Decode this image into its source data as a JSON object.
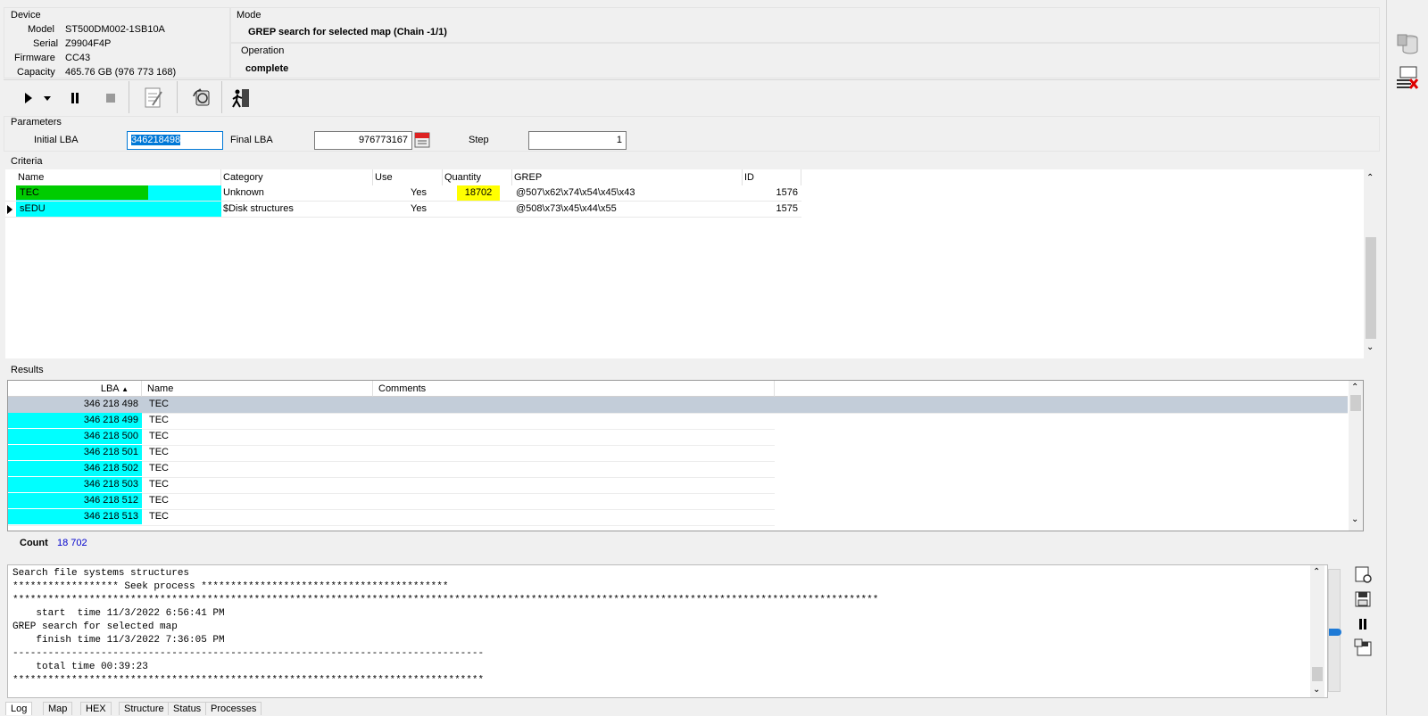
{
  "device": {
    "title": "Device",
    "model_label": "Model",
    "model": "ST500DM002-1SB10A",
    "serial_label": "Serial",
    "serial": "Z9904F4P",
    "firmware_label": "Firmware",
    "firmware": "CC43",
    "capacity_label": "Capacity",
    "capacity": "465.76 GB (976 773 168)"
  },
  "mode": {
    "title": "Mode",
    "value": "GREP search for selected map (Chain -1/1)"
  },
  "operation": {
    "title": "Operation",
    "value": "complete"
  },
  "parameters": {
    "title": "Parameters",
    "initial_lba_label": "Initial LBA",
    "initial_lba": "346218498",
    "final_lba_label": "Final  LBA",
    "final_lba": "976773167",
    "step_label": "Step",
    "step": "1"
  },
  "criteria": {
    "title": "Criteria",
    "columns": [
      "Name",
      "Category",
      "Use",
      "Quantity",
      "GREP",
      "ID"
    ],
    "rows": [
      {
        "name": "TEC",
        "category": "Unknown",
        "use": "Yes",
        "quantity": "18702",
        "grep": "@507\\x62\\x74\\x54\\x45\\x43",
        "id": "1576"
      },
      {
        "name": "sEDU",
        "category": "$Disk structures",
        "use": "Yes",
        "quantity": "",
        "grep": "@508\\x73\\x45\\x44\\x55",
        "id": "1575"
      }
    ]
  },
  "results": {
    "title": "Results",
    "columns": [
      "LBA",
      "Name",
      "Comments"
    ],
    "rows": [
      {
        "lba": "346 218 498",
        "name": "TEC",
        "comments": ""
      },
      {
        "lba": "346 218 499",
        "name": "TEC",
        "comments": ""
      },
      {
        "lba": "346 218 500",
        "name": "TEC",
        "comments": ""
      },
      {
        "lba": "346 218 501",
        "name": "TEC",
        "comments": ""
      },
      {
        "lba": "346 218 502",
        "name": "TEC",
        "comments": ""
      },
      {
        "lba": "346 218 503",
        "name": "TEC",
        "comments": ""
      },
      {
        "lba": "346 218 512",
        "name": "TEC",
        "comments": ""
      },
      {
        "lba": "346 218 513",
        "name": "TEC",
        "comments": ""
      }
    ],
    "count_label": "Count",
    "count": "18 702"
  },
  "log": {
    "lines": [
      "Search file systems structures",
      "****************** Seek process ******************************************",
      "***************************************************************************************************************************************************",
      "    start  time 11/3/2022 6:56:41 PM",
      "GREP search for selected map",
      "    finish time 11/3/2022 7:36:05 PM",
      "--------------------------------------------------------------------------------",
      "    total time 00:39:23",
      "********************************************************************************"
    ]
  },
  "tabs": [
    "Log",
    "Map",
    "HEX",
    "Structure",
    "Status",
    "Processes"
  ],
  "colors": {
    "cyan": "#00ffff",
    "green": "#00cc00",
    "yellow": "#ffff00",
    "selected_row": "#c3cdd9",
    "count_blue": "#0000cc",
    "progress_blue": "#1e7ad6"
  },
  "icons": {
    "toolbar": [
      "play-icon",
      "dropdown-arrow-icon",
      "pause-icon",
      "stop-icon",
      "notes-icon",
      "refresh-disk-icon",
      "exit-icon"
    ],
    "side": [
      "database-icon",
      "close-panel-icon"
    ],
    "log": [
      "settings-icon",
      "save-icon",
      "pause-icon",
      "save-as-icon"
    ]
  }
}
